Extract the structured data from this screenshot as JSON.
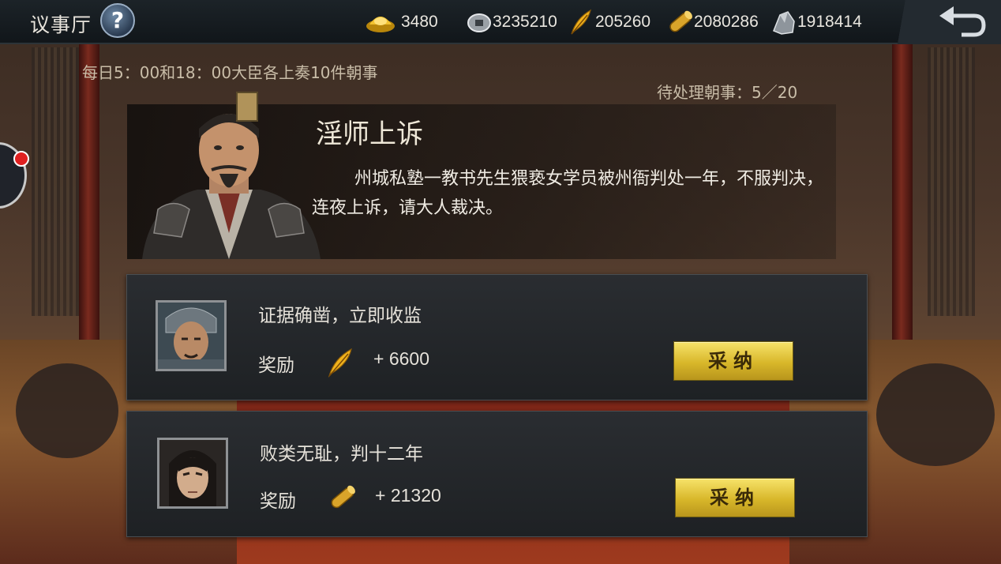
{
  "header": {
    "title": "议事厅",
    "help_label": "?",
    "resources": [
      {
        "icon": "gold-ingot-icon",
        "value": "3480"
      },
      {
        "icon": "silver-coin-icon",
        "value": "3235210"
      },
      {
        "icon": "feather-icon",
        "value": "205260"
      },
      {
        "icon": "bamboo-scroll-icon",
        "value": "2080286"
      },
      {
        "icon": "ore-icon",
        "value": "1918414"
      }
    ]
  },
  "info": {
    "daily_note": "每日5：00和18：00大臣各上奏10件朝事",
    "pending": "待处理朝事：5／20"
  },
  "case": {
    "title": "淫师上诉",
    "description": "州城私塾一教书先生猥亵女学员被州衙判处一年，不服判决，连夜上诉，请大人裁决。"
  },
  "options": [
    {
      "text": "证据确凿，立即收监",
      "reward_label": "奖励",
      "reward_icon": "feather-icon",
      "reward_amount": "+ 6600",
      "button": "采纳"
    },
    {
      "text": "败类无耻，判十二年",
      "reward_label": "奖励",
      "reward_icon": "bamboo-scroll-icon",
      "reward_amount": "+ 21320",
      "button": "采纳"
    }
  ],
  "colors": {
    "accent_gold": "#d8b72a",
    "topbar": "#1c2328"
  }
}
